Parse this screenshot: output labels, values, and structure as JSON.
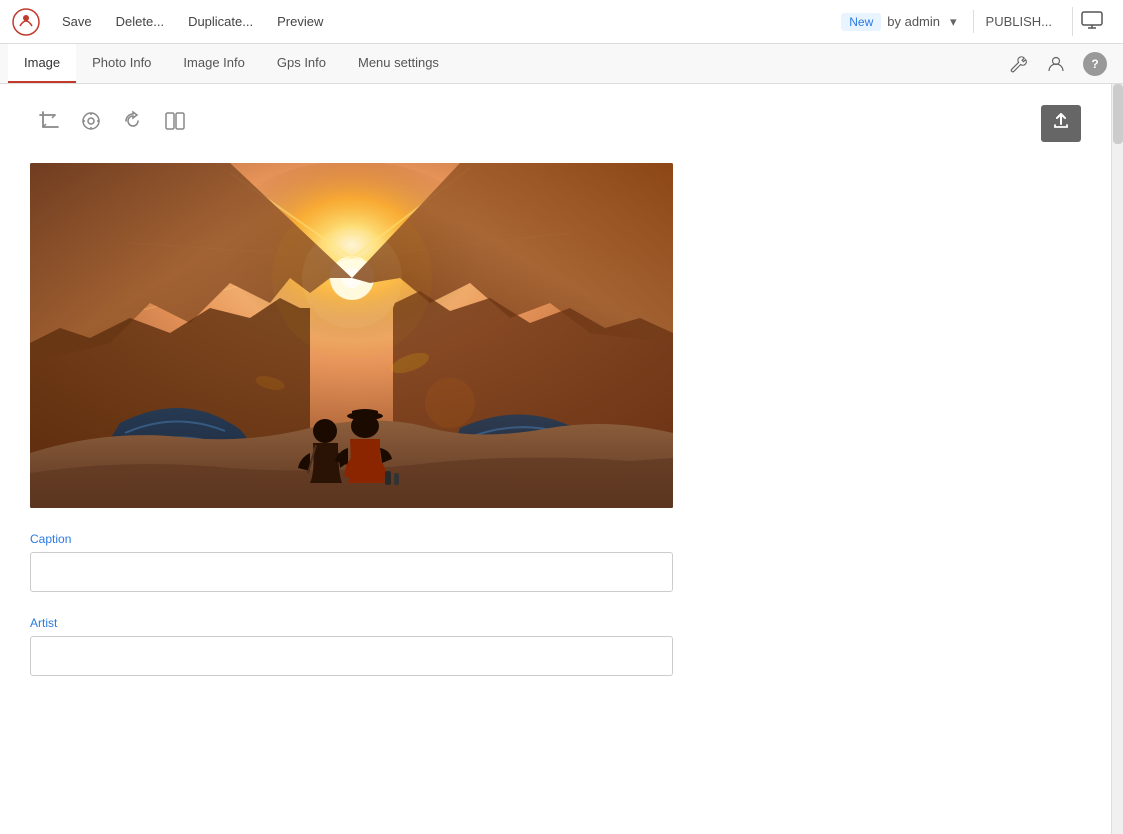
{
  "app": {
    "logo_alt": "App Logo"
  },
  "toolbar": {
    "save_label": "Save",
    "delete_label": "Delete...",
    "duplicate_label": "Duplicate...",
    "preview_label": "Preview",
    "status": {
      "badge": "New",
      "by_label": "by admin"
    },
    "publish_label": "PUBLISH..."
  },
  "tabs": {
    "items": [
      {
        "id": "image",
        "label": "Image",
        "active": true
      },
      {
        "id": "photo-info",
        "label": "Photo Info",
        "active": false
      },
      {
        "id": "image-info",
        "label": "Image Info",
        "active": false
      },
      {
        "id": "gps-info",
        "label": "Gps Info",
        "active": false
      },
      {
        "id": "menu-settings",
        "label": "Menu settings",
        "active": false
      }
    ],
    "wrench_icon": "⚙",
    "user_icon": "👤",
    "help_label": "?"
  },
  "image_toolbar": {
    "crop_icon": "✂",
    "focus_icon": "◎",
    "rotate_icon": "↺",
    "compare_icon": "⧉",
    "upload_icon": "⬆"
  },
  "fields": {
    "caption_label": "Caption",
    "caption_placeholder": "",
    "artist_label": "Artist",
    "artist_placeholder": ""
  }
}
